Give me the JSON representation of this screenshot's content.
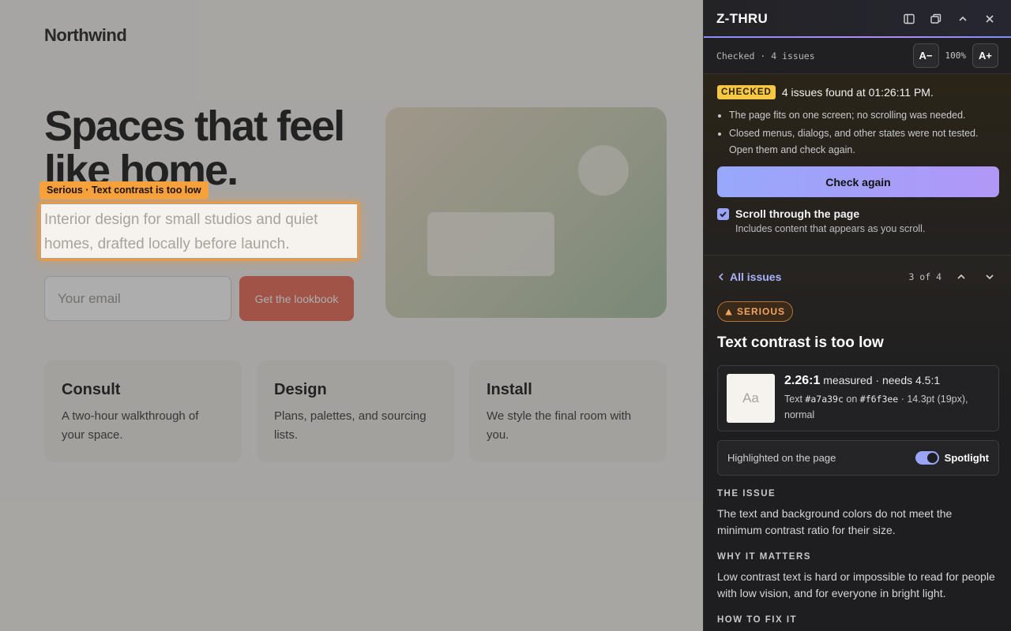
{
  "site": {
    "logo": "Northwind",
    "headline": "Spaces that feel like home.",
    "subtitle": "Interior design for small studios and quiet homes, drafted locally before launch.",
    "email_placeholder": "Your email",
    "cta": "Get the lookbook",
    "cards": [
      {
        "title": "Consult",
        "text": "A two-hour walkthrough of your space."
      },
      {
        "title": "Design",
        "text": "Plans, palettes, and sourcing lists."
      },
      {
        "title": "Install",
        "text": "We style the final room with you."
      }
    ]
  },
  "highlight": {
    "tag": "Serious · Text contrast is too low",
    "color": "#f39a36"
  },
  "panel": {
    "title": "Z-THRU",
    "header_icons": [
      "sidebar-icon",
      "popout-icon",
      "collapse-icon",
      "close-icon"
    ],
    "status": "Checked · 4 issues",
    "zoom_out": "A−",
    "zoom_level": "100%",
    "zoom_in": "A+",
    "summary": {
      "badge": "CHECKED",
      "message": "4 issues found at 01:26:11 PM.",
      "notes": [
        "The page fits on one screen; no scrolling was needed.",
        "Closed menus, dialogs, and other states were not tested. Open them and check again."
      ],
      "check_again": "Check again",
      "scroll_label": "Scroll through the page",
      "scroll_sub": "Includes content that appears as you scroll.",
      "scroll_checked": true
    },
    "issue": {
      "back_label": "All issues",
      "position": "3 of 4",
      "severity": "SERIOUS",
      "title": "Text contrast is too low",
      "ratio": "2.26:1",
      "ratio_suffix": "measured · needs 4.5:1",
      "text_label": "Text",
      "fg": "#a7a39c",
      "on_label": "on",
      "bg": "#f6f3ee",
      "size_info": "· 14.3pt (19px), normal",
      "swatch_text": "Aa",
      "spotlight_label": "Highlighted on the page",
      "spotlight_toggle": "Spotlight",
      "spotlight_on": true,
      "sections": [
        {
          "heading": "THE ISSUE",
          "body": "The text and background colors do not meet the minimum contrast ratio for their size."
        },
        {
          "heading": "WHY IT MATTERS",
          "body": "Low contrast text is hard or impossible to read for people with low vision, and for everyone in bright light."
        },
        {
          "heading": "HOW TO FIX IT",
          "body": ""
        }
      ]
    }
  }
}
